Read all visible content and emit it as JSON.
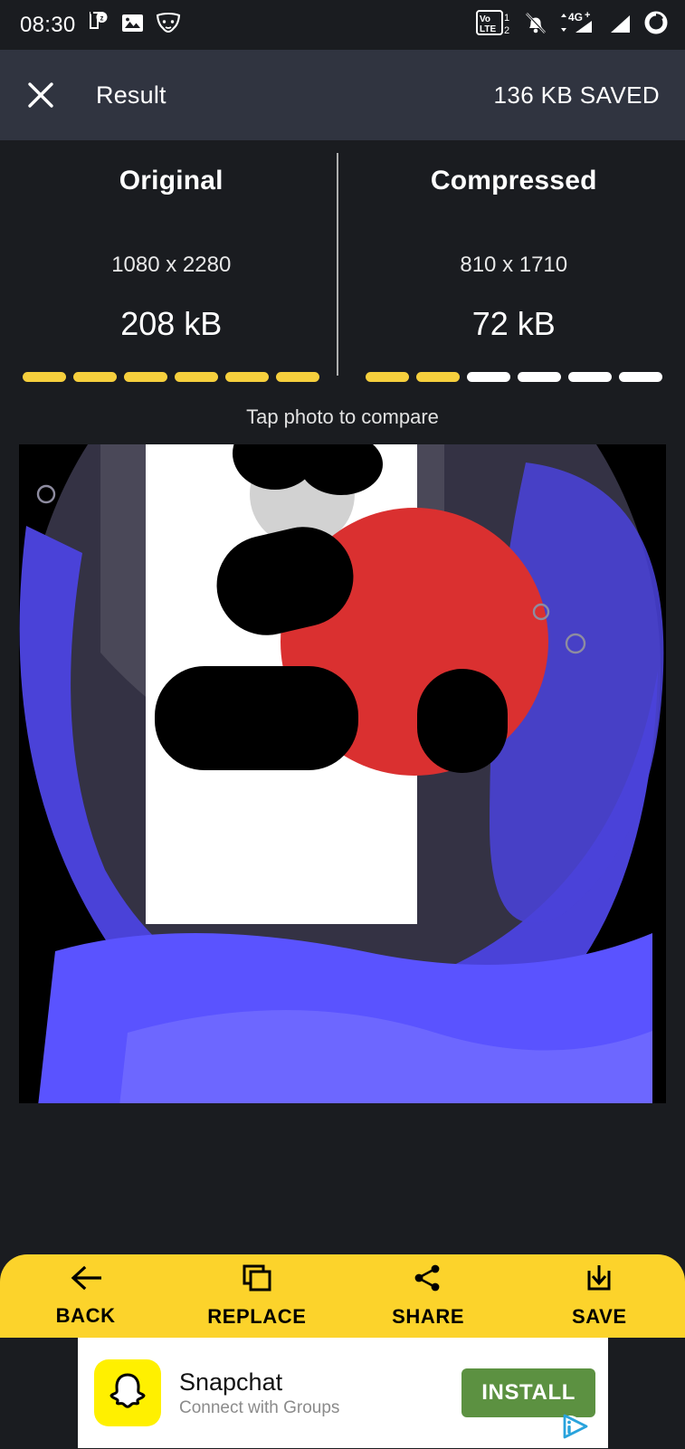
{
  "statusbar": {
    "clock": "08:30",
    "left_icons": [
      "document-badge-icon",
      "photo-icon",
      "fox-mask-icon"
    ],
    "right_icons": [
      "volte-dual-sim-icon",
      "notifications-muted-icon",
      "signal-4g-plus-icon",
      "signal-bars-icon",
      "battery-ring-icon"
    ],
    "volte_line1": "Vo",
    "volte_line2": "LTE",
    "sim1": "1",
    "sim2": "2",
    "network_label": "4G"
  },
  "appbar": {
    "close_icon": "close-icon",
    "title": "Result",
    "saved_label": "136 KB SAVED"
  },
  "compare": {
    "original": {
      "title": "Original",
      "dimensions": "1080 x 2280",
      "size": "208 kB",
      "segments_total": 6,
      "segments_filled": 6
    },
    "compressed": {
      "title": "Compressed",
      "dimensions": "810 x 1710",
      "size": "72 kB",
      "segments_total": 6,
      "segments_filled": 2
    },
    "hint": "Tap photo to compare",
    "accent_color": "#f6cf3d",
    "empty_color": "#ffffff"
  },
  "preview": {
    "name": "compressed-photo-preview"
  },
  "actions": [
    {
      "label": "BACK",
      "icon": "arrow-left-icon"
    },
    {
      "label": "REPLACE",
      "icon": "copy-layers-icon"
    },
    {
      "label": "SHARE",
      "icon": "share-nodes-icon"
    },
    {
      "label": "SAVE",
      "icon": "download-save-icon"
    }
  ],
  "actionbar": {
    "background": "#fcd32b"
  },
  "ad": {
    "app_name": "Snapchat",
    "tagline": "Connect with Groups",
    "cta": "INSTALL",
    "cta_color": "#5c9141",
    "icon": "snapchat-ghost-icon",
    "adchoices_icon": "adchoices-icon"
  }
}
